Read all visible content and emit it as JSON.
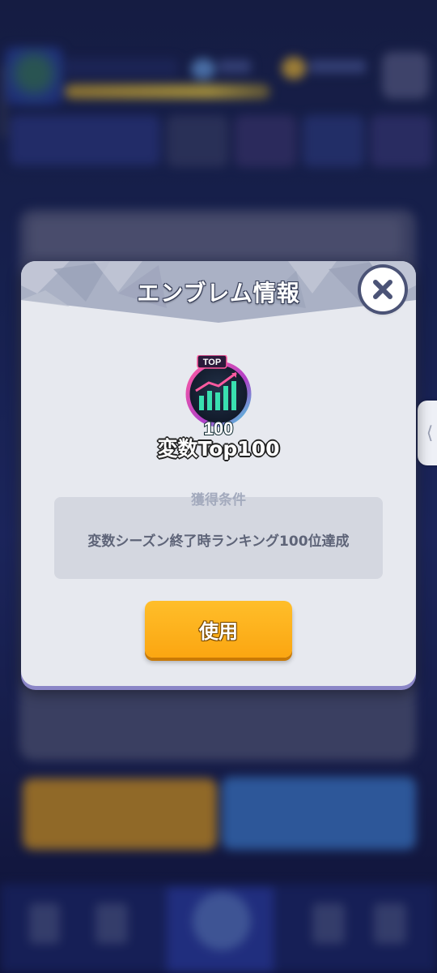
{
  "dialog": {
    "title": "エンブレム情報",
    "close_icon": "close-icon",
    "emblem": {
      "icon": "top100-emblem-icon",
      "badge_top_text": "TOP",
      "badge_bottom_text": "100",
      "name": "変数Top100"
    },
    "condition": {
      "label": "獲得条件",
      "text": "変数シーズン終了時ランキング100位達成"
    },
    "use_button_label": "使用"
  },
  "side_handle": {
    "icon": "chevron-left-icon",
    "glyph": "⟨"
  },
  "colors": {
    "dialog_bg": "#e7e9ef",
    "header_bg": "#aab1c5",
    "button_orange": "#fba611",
    "close_ring": "#4b5376",
    "emblem_ring": "#e44a8a",
    "emblem_bars": "#39e0b0"
  }
}
